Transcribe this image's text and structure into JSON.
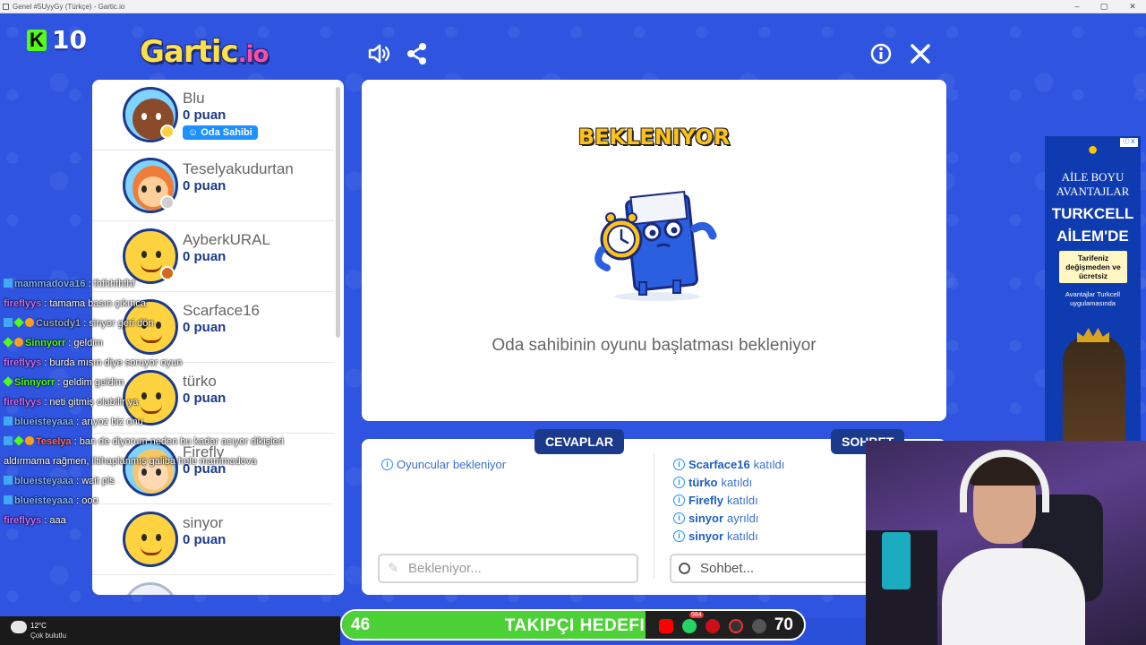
{
  "window": {
    "title": "Genel #5UyyGy (Türkçe) - Gartic.io"
  },
  "header": {
    "kick_count": "10",
    "logo_text": "Gartic",
    "logo_suffix": "io"
  },
  "players": [
    {
      "name": "Blu",
      "points": "0 puan",
      "badge": "Oda Sahibi",
      "status_color": "#ffd23f",
      "avatar_color": "#8a4b2a"
    },
    {
      "name": "Teselyakudurtan",
      "points": "0 puan",
      "badge": "",
      "status_color": "#cfcfcf",
      "avatar_color": "#f07c3a"
    },
    {
      "name": "AyberkURAL",
      "points": "0 puan",
      "badge": "",
      "status_color": "#d2691e",
      "avatar_color": "#ffd23f"
    },
    {
      "name": "Scarface16",
      "points": "0 puan",
      "badge": "",
      "status_color": "",
      "avatar_color": "#ffd23f"
    },
    {
      "name": "türko",
      "points": "0 puan",
      "badge": "",
      "status_color": "",
      "avatar_color": "#ffd23f"
    },
    {
      "name": "Firefly",
      "points": "0 puan",
      "badge": "",
      "status_color": "",
      "avatar_color": "#ffd23f"
    },
    {
      "name": "sinyor",
      "points": "0 puan",
      "badge": "",
      "status_color": "",
      "avatar_color": "#ffd23f"
    }
  ],
  "board": {
    "title": "BEKLENIYOR",
    "message": "Oda sahibinin oyunu başlatması bekleniyor"
  },
  "answers": {
    "tab_label": "CEVAPLAR",
    "info": "Oyuncular bekleniyor",
    "input_placeholder": "Bekleniyor..."
  },
  "chat_panel": {
    "tab_label": "SOHBET",
    "events": [
      {
        "name": "Scarface16",
        "action": "katıldı"
      },
      {
        "name": "türko",
        "action": "katıldı"
      },
      {
        "name": "Firefly",
        "action": "katıldı"
      },
      {
        "name": "sinyor",
        "action": "ayrıldı"
      },
      {
        "name": "sinyor",
        "action": "katıldı"
      }
    ],
    "input_placeholder": "Sohbet..."
  },
  "stream_chat": [
    {
      "user": "mammadova16",
      "text": ": fhfhhfhfhf",
      "color": "#7fb2ff",
      "badges": "sq"
    },
    {
      "user": "fireflyys",
      "text": ": tamama basın çıkınca",
      "color": "#c96bff",
      "badges": ""
    },
    {
      "user": "Custody1",
      "text": ": sinyor geri dön",
      "color": "#9aa7c7",
      "badges": "sqgo"
    },
    {
      "user": "Sinnyorr",
      "text": ": geldim",
      "color": "#53fc18",
      "badges": "go"
    },
    {
      "user": "fireflyys",
      "text": ": burda mısın diye soruyor oyun",
      "color": "#c96bff",
      "badges": ""
    },
    {
      "user": "Sinnyorr",
      "text": ": geldim geldim",
      "color": "#53fc18",
      "badges": "g"
    },
    {
      "user": "fireflyys",
      "text": ": neti gitmiş olabilir ya",
      "color": "#c96bff",
      "badges": ""
    },
    {
      "user": "blueisteyaaa",
      "text": ": arıyoz biz onu",
      "color": "#7fb2ff",
      "badges": "sq"
    },
    {
      "user": "Teselya",
      "text": ": ban de diyorum neden bu kadar acıyor dikişleri",
      "color": "#ff6b6b",
      "badges": "sqgo"
    },
    {
      "user": "",
      "text": "aldırmama rağmen, iltihaplanmış galiba hele mammadova",
      "color": "#ffffff",
      "badges": ""
    },
    {
      "user": "blueisteyaaa",
      "text": ": wait pls",
      "color": "#7fb2ff",
      "badges": "sq"
    },
    {
      "user": "blueisteyaaa",
      "text": ": ooo",
      "color": "#7fb2ff",
      "badges": "sq"
    },
    {
      "user": "fireflyys",
      "text": ": aaa",
      "color": "#c96bff",
      "badges": ""
    }
  ],
  "ad": {
    "brand_symbol": "●",
    "headline1": "AİLE BOYU AVANTAJLAR",
    "headline2": "TURKCELL AİLEM'DE",
    "note": "Tarifeniz değişmeden ve ücretsiz",
    "note2": "Avantajlar Turkcell uygulamasında",
    "info_label": "ⓘ X"
  },
  "goal": {
    "current": "46",
    "label": "TAKIPÇI HEDEFI",
    "target": "70",
    "progress_fraction": 0.657,
    "social_badge": "984"
  },
  "taskbar": {
    "temp": "12°C",
    "weather": "Çok bulutlu"
  },
  "colors": {
    "background": "#2f55e0",
    "accent_dark": "#1c3a8c",
    "goal_fill": "#4cd137"
  }
}
